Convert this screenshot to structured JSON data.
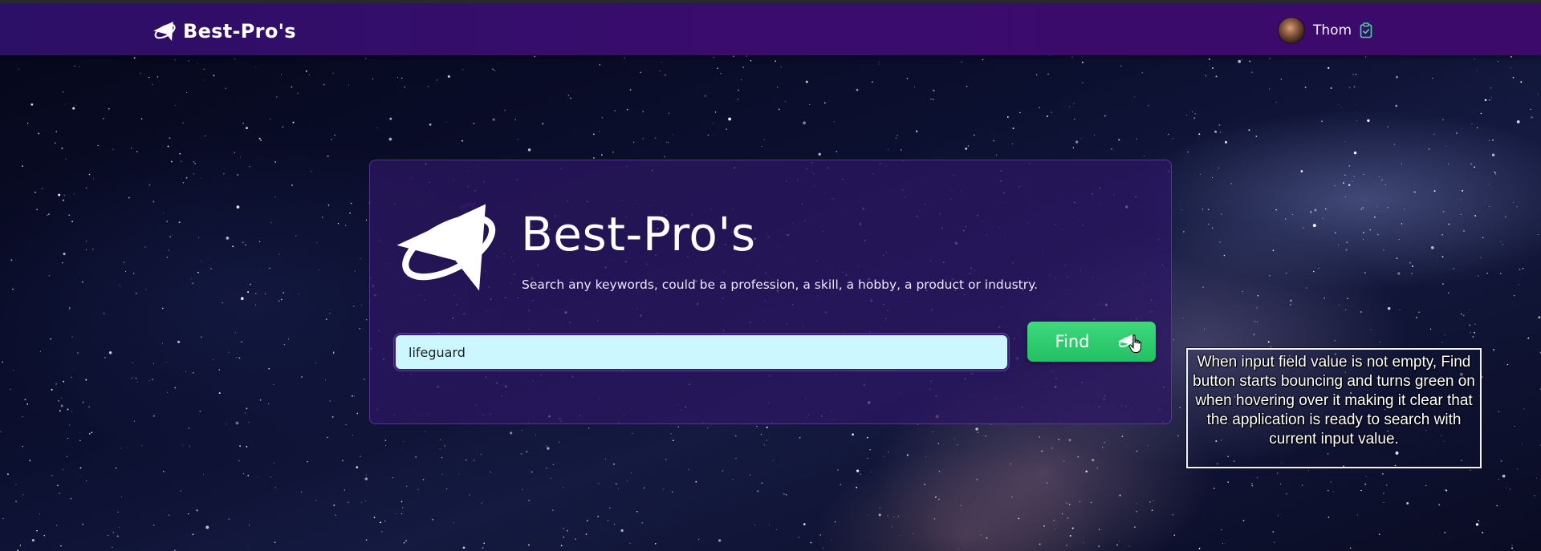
{
  "navbar": {
    "brand_name": "Best-Pro's",
    "brand_icon": "rocket-logo-icon",
    "user_name": "Thom",
    "user_icon": "clipboard-check-icon"
  },
  "card": {
    "title": "Best-Pro's",
    "subtitle": "Search any keywords, could be a profession, a skill, a hobby, a product or industry.",
    "logo_icon": "rocket-logo-icon"
  },
  "search": {
    "value": "lifeguard",
    "placeholder": ""
  },
  "find_button": {
    "label": "Find",
    "icon": "rocket-logo-icon"
  },
  "annotation": {
    "text": "When input field value is not empty, Find button starts bouncing and turns green on when hovering over it making it clear that the application is ready to search with current input value."
  },
  "colors": {
    "navbar": "#3a0c6e",
    "card": "#2c1664",
    "input_bg": "#cdf7ff",
    "find_button": "#2ecc71",
    "accent_icon": "#3ddc97"
  }
}
